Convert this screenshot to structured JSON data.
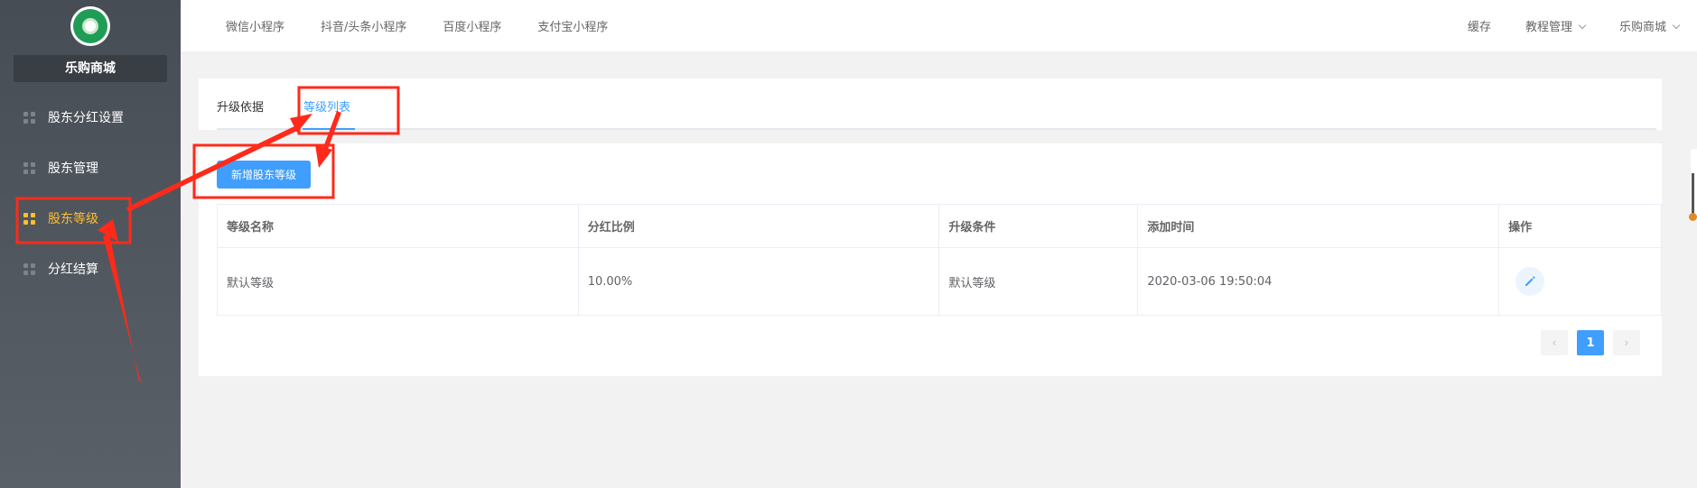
{
  "sidebar": {
    "shop_name": "乐购商城",
    "items": [
      {
        "label": "股东分红设置",
        "active": false
      },
      {
        "label": "股东管理",
        "active": false
      },
      {
        "label": "股东等级",
        "active": true
      },
      {
        "label": "分红结算",
        "active": false
      }
    ]
  },
  "topbar": {
    "nav": [
      "微信小程序",
      "抖音/头条小程序",
      "百度小程序",
      "支付宝小程序"
    ],
    "right": {
      "cache": "缓存",
      "tutorial": "教程管理",
      "shop": "乐购商城"
    }
  },
  "tabs": [
    {
      "label": "升级依据",
      "active": false
    },
    {
      "label": "等级列表",
      "active": true
    }
  ],
  "main": {
    "add_button": "新增股东等级",
    "table": {
      "headers": [
        "等级名称",
        "分红比例",
        "升级条件",
        "添加时间",
        "操作"
      ],
      "rows": [
        {
          "name": "默认等级",
          "ratio": "10.00%",
          "condition": "默认等级",
          "time": "2020-03-06 19:50:04"
        }
      ]
    },
    "pagination": {
      "current": "1"
    }
  },
  "colors": {
    "accent": "#409eff",
    "active_menu": "#ffbf2e",
    "annotation": "#ff2a1a"
  }
}
